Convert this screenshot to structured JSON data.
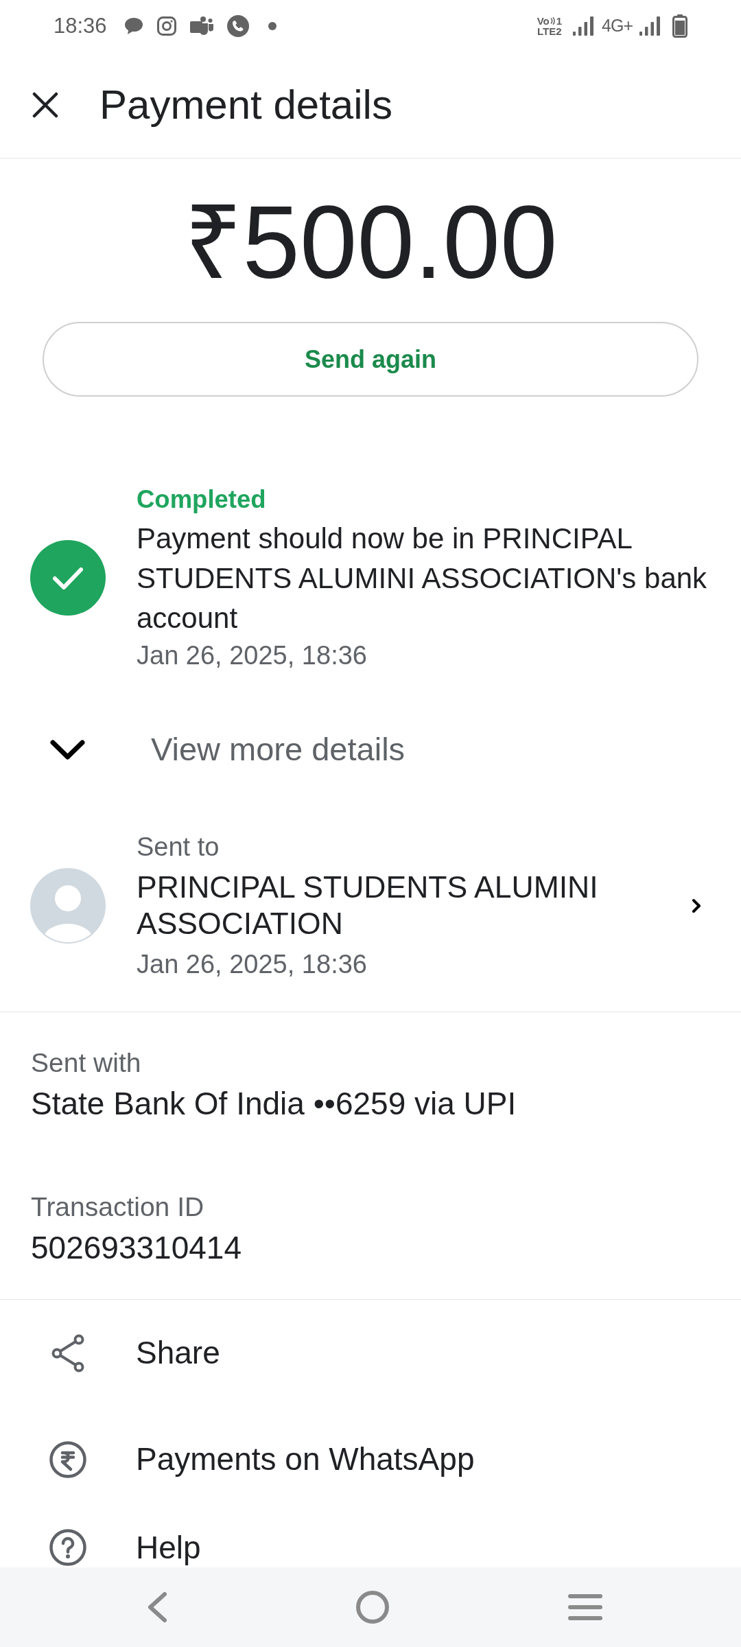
{
  "status_bar": {
    "time": "18:36",
    "volte": {
      "top": "Vo",
      "slot": "1",
      "bottom": "LTE2"
    },
    "network": "4G+"
  },
  "header": {
    "title": "Payment details"
  },
  "amount": "₹500.00",
  "send_again_button": {
    "label": "Send again"
  },
  "status": {
    "kind": "completed",
    "label": "Completed",
    "message": "Payment should now be in PRINCIPAL STUDENTS ALUMINI ASSOCIATION's bank account",
    "timestamp": "Jan 26, 2025, 18:36"
  },
  "more_details": {
    "label": "View more details",
    "expanded": false
  },
  "recipient": {
    "label": "Sent to",
    "name": "PRINCIPAL STUDENTS ALUMINI ASSOCIATION",
    "timestamp": "Jan 26, 2025, 18:36"
  },
  "details": [
    {
      "label": "Sent with",
      "value": "State Bank Of India ••6259 via UPI"
    },
    {
      "label": "Transaction ID",
      "value": "502693310414"
    }
  ],
  "actions": [
    {
      "kind": "share",
      "label": "Share"
    },
    {
      "kind": "payments",
      "label": "Payments on WhatsApp"
    },
    {
      "kind": "help",
      "label": "Help"
    }
  ]
}
